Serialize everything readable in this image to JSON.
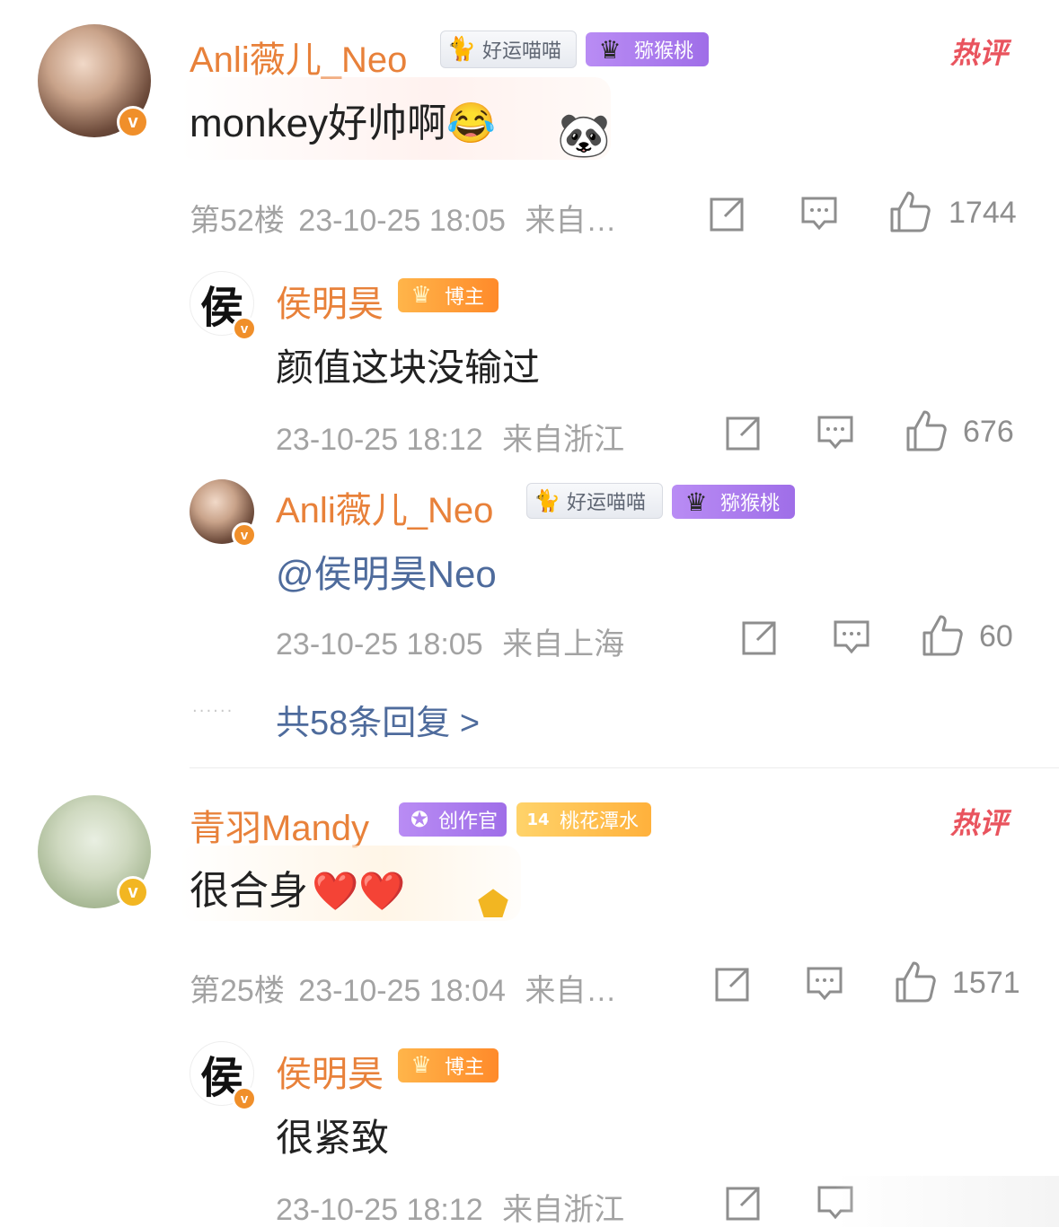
{
  "comments": [
    {
      "author": "Anli薇儿_Neo",
      "badges": [
        "好运喵喵",
        "猕猴桃"
      ],
      "hot_label": "热评",
      "text": "monkey好帅啊",
      "emoji": "😂",
      "floor": "第52楼",
      "time": "23-10-25 18:05",
      "location": "来自…",
      "likes": "1744",
      "replies": [
        {
          "author": "侯明昊",
          "avatar_char": "侯",
          "badge": "博主",
          "text": "颜值这块没输过",
          "time": "23-10-25 18:12",
          "location": "来自浙江",
          "likes": "676"
        },
        {
          "author": "Anli薇儿_Neo",
          "badges": [
            "好运喵喵",
            "猕猴桃"
          ],
          "mention": "@侯明昊Neo",
          "time": "23-10-25 18:05",
          "location": "来自上海",
          "likes": "60"
        }
      ],
      "dots": "······",
      "more_replies": "共58条回复 >"
    },
    {
      "author": "青羽Mandy",
      "badges": [
        "创作官",
        "桃花潭水"
      ],
      "level": "14",
      "hot_label": "热评",
      "text": "很合身",
      "emoji": "❤️❤️",
      "floor": "第25楼",
      "time": "23-10-25 18:04",
      "location": "来自…",
      "likes": "1571",
      "replies": [
        {
          "author": "侯明昊",
          "avatar_char": "侯",
          "badge": "博主",
          "text": "很紧致",
          "time": "23-10-25 18:12",
          "location": "来自浙江"
        }
      ]
    }
  ],
  "icons": {
    "share": "share-icon",
    "comment": "comment-icon",
    "like": "like-icon"
  },
  "colors": {
    "username": "#e8813a",
    "hot": "#e9545e",
    "link": "#4e6b9c",
    "meta": "#a3a3a3"
  }
}
